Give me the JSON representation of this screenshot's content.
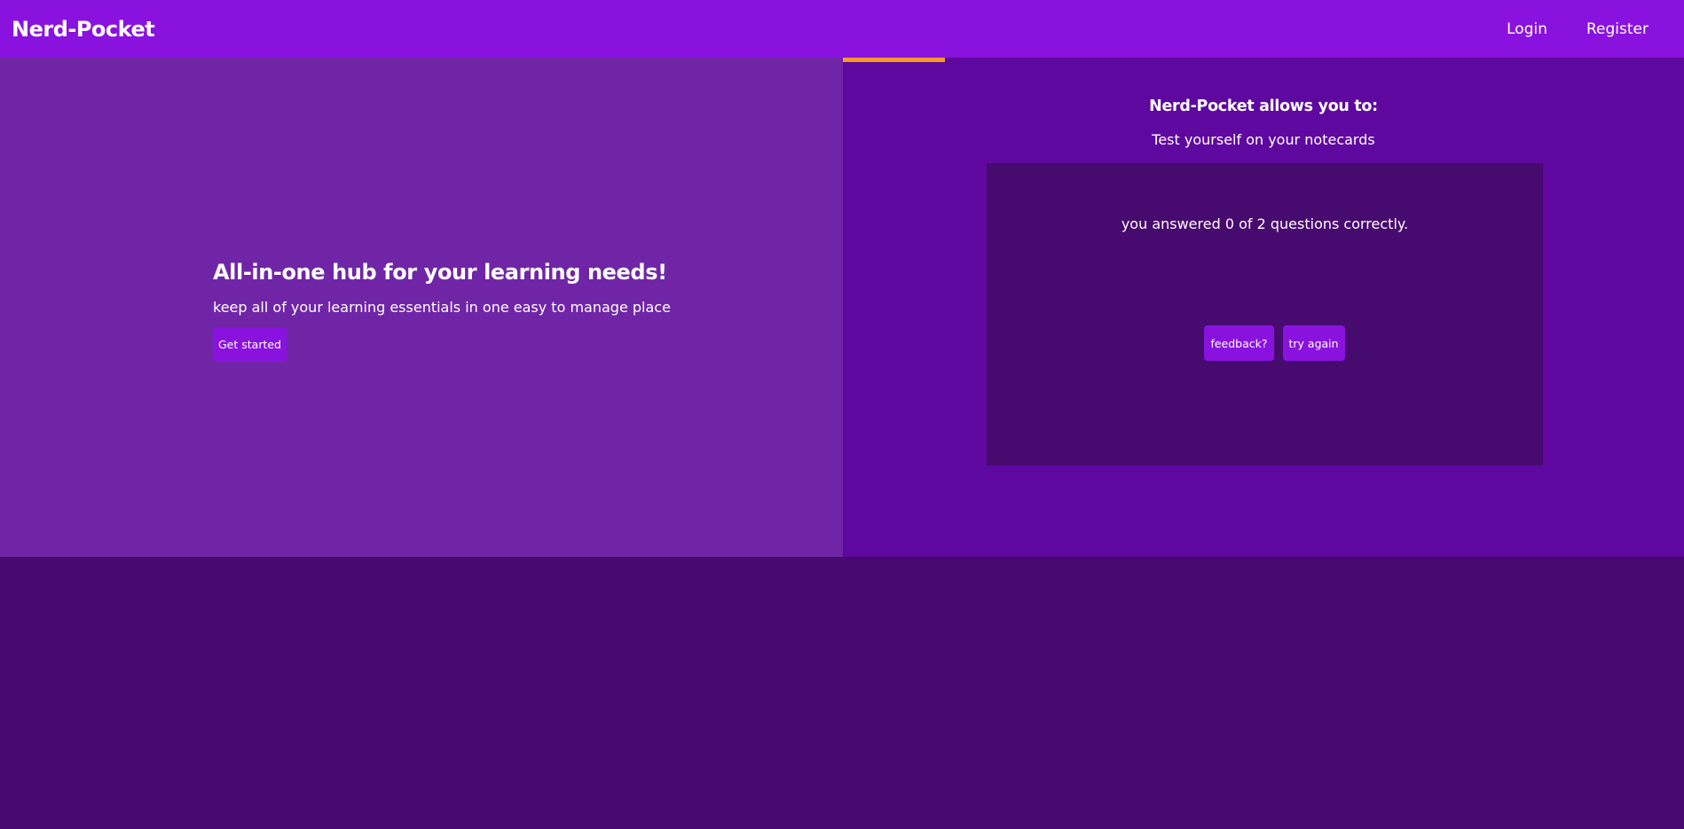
{
  "navbar": {
    "brand": "Nerd-Pocket",
    "links": {
      "login": "Login",
      "register": "Register"
    }
  },
  "hero": {
    "title": "All-in-one hub for your learning needs!",
    "subtitle": "keep all of your learning essentials in one easy to manage place",
    "cta_label": "Get started"
  },
  "features": {
    "heading": "Nerd-Pocket allows you to:",
    "current_item": "Test yourself on your notecards"
  },
  "quiz": {
    "result": "you answered 0 of 2 questions correctly.",
    "feedback_label": "feedback?",
    "retry_label": "try again"
  },
  "colors": {
    "navbar": "#8a12df",
    "hero_left": "#7025a7",
    "hero_right": "#5e08a0",
    "card": "#470a6e",
    "accent": "#f59a23",
    "button": "#8a12df"
  }
}
